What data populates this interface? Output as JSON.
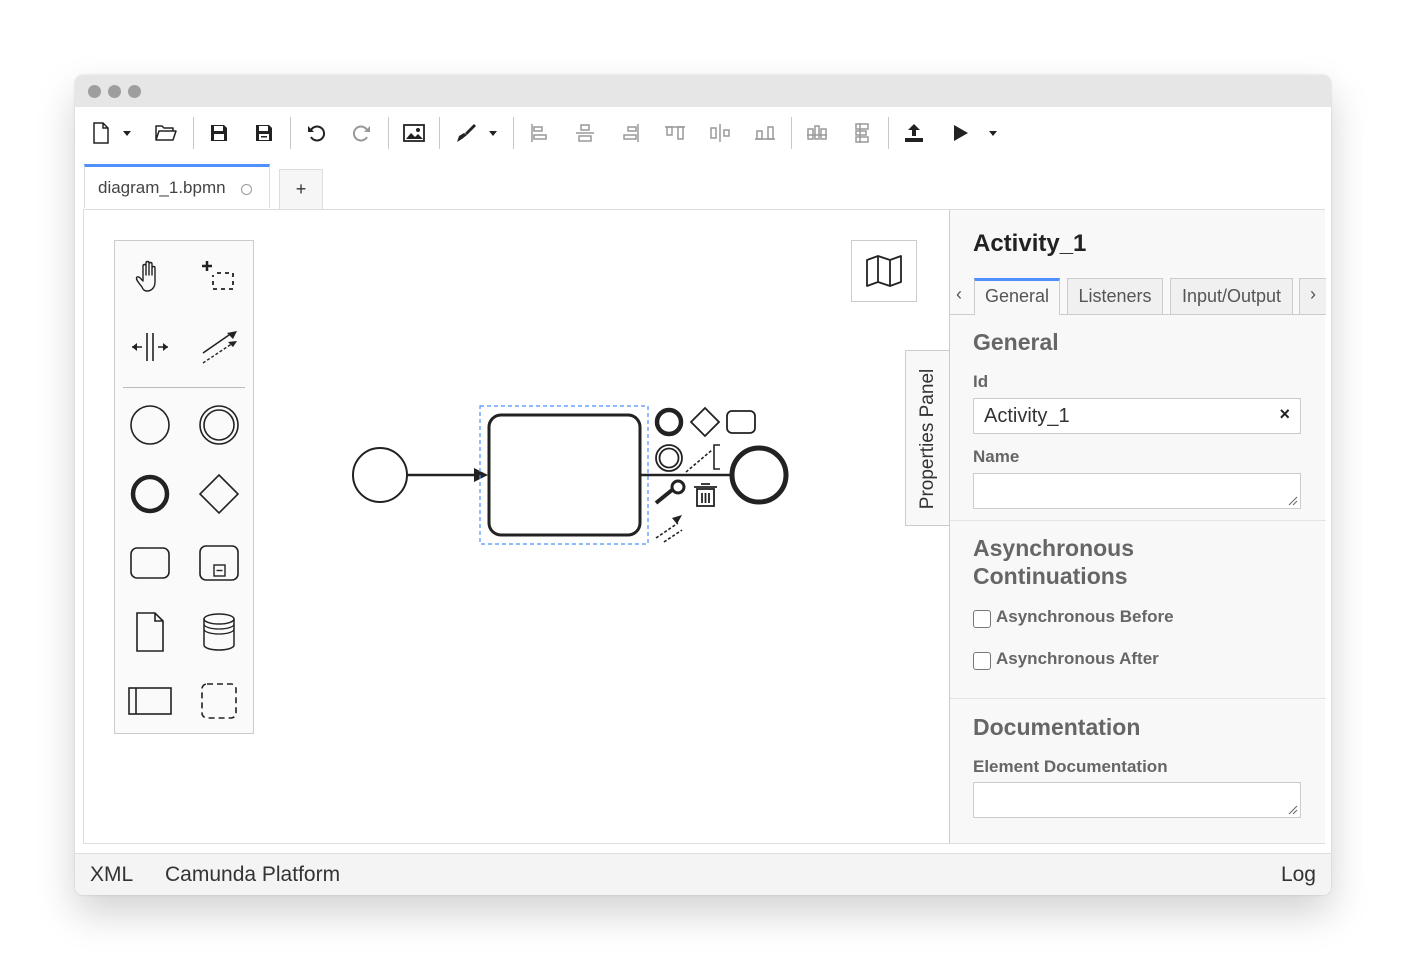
{
  "toolbar": {
    "buttons": [
      "new-file",
      "open-file",
      "save",
      "save-as",
      "undo",
      "redo",
      "export-image",
      "color-picker",
      "align-left",
      "align-center",
      "align-right",
      "align-top",
      "align-middle",
      "align-bottom",
      "distribute-horizontal",
      "distribute-vertical",
      "deploy",
      "start-instance"
    ]
  },
  "tabs": {
    "active": "diagram_1.bpmn",
    "add_label": "+"
  },
  "properties_toggle": "Properties Panel",
  "panel": {
    "title": "Activity_1",
    "tabs": [
      "General",
      "Listeners",
      "Input/Output"
    ],
    "general": {
      "heading": "General",
      "id_label": "Id",
      "id_value": "Activity_1",
      "clear": "×",
      "name_label": "Name",
      "name_value": ""
    },
    "async": {
      "heading_line1": "Asynchronous",
      "heading_line2": "Continuations",
      "before_label": "Asynchronous Before",
      "after_label": "Asynchronous After",
      "before_checked": false,
      "after_checked": false
    },
    "documentation": {
      "heading": "Documentation",
      "label": "Element Documentation",
      "value": ""
    }
  },
  "statusbar": {
    "xml": "XML",
    "platform": "Camunda Platform",
    "log": "Log"
  },
  "colors": {
    "accent": "#4d90fe",
    "selection": "#4d90fe"
  }
}
